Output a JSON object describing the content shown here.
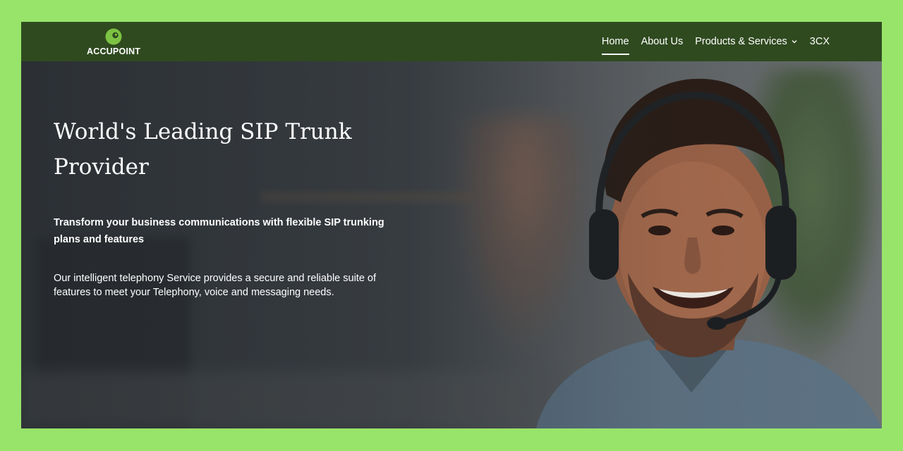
{
  "brand": {
    "name": "ACCUPOINT",
    "logo_icon": "accupoint-logo-icon",
    "accent_color": "#7cc243"
  },
  "nav": {
    "items": [
      {
        "label": "Home",
        "active": true
      },
      {
        "label": "About Us",
        "active": false
      },
      {
        "label": "Products & Services",
        "active": false,
        "has_dropdown": true,
        "icon": "chevron-down-icon"
      },
      {
        "label": "3CX",
        "active": false
      }
    ],
    "background": "#2f4a1f"
  },
  "hero": {
    "title": "World's Leading SIP Trunk Provider",
    "subtitle": "Transform your business communications with flexible SIP trunking plans and features",
    "body": "Our intelligent telephony Service provides a secure and reliable suite of features to meet your Telephony, voice and messaging needs.",
    "image": "smiling-man-with-headset-photo"
  },
  "page_border_color": "#98e46a"
}
